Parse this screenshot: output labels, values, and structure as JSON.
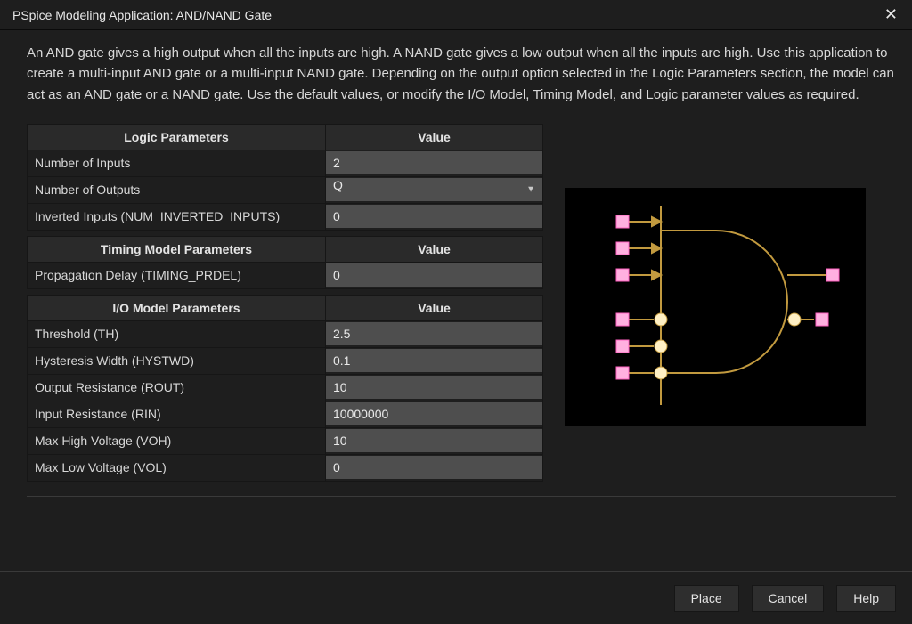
{
  "title": "PSpice Modeling Application: AND/NAND Gate",
  "description": "An AND gate gives a high output when all the inputs are high. A NAND gate gives a low output when all the inputs are high. Use this application to create a multi-input AND gate or a multi-input NAND gate. Depending on the output option selected in the Logic Parameters section, the model can act as an AND gate or a NAND gate. Use the default values, or modify the I/O Model, Timing Model, and Logic parameter values as required.",
  "sections": {
    "logic": {
      "header_label": "Logic Parameters",
      "header_value": "Value",
      "rows": {
        "num_inputs": {
          "label": "Number of Inputs",
          "value": "2"
        },
        "num_outputs": {
          "label": "Number of Outputs",
          "value": "Q"
        },
        "inverted_inputs": {
          "label": "Inverted Inputs (NUM_INVERTED_INPUTS)",
          "value": "0"
        }
      }
    },
    "timing": {
      "header_label": "Timing Model Parameters",
      "header_value": "Value",
      "rows": {
        "prop_delay": {
          "label": "Propagation Delay (TIMING_PRDEL)",
          "value": "0"
        }
      }
    },
    "io": {
      "header_label": "I/O Model Parameters",
      "header_value": "Value",
      "rows": {
        "threshold": {
          "label": "Threshold (TH)",
          "value": "2.5"
        },
        "hysteresis": {
          "label": "Hysteresis Width (HYSTWD)",
          "value": "0.1"
        },
        "rout": {
          "label": "Output Resistance (ROUT)",
          "value": "10"
        },
        "rin": {
          "label": "Input Resistance (RIN)",
          "value": "10000000"
        },
        "voh": {
          "label": "Max High Voltage (VOH)",
          "value": "10"
        },
        "vol": {
          "label": "Max Low Voltage (VOL)",
          "value": "0"
        }
      }
    }
  },
  "buttons": {
    "place": "Place",
    "cancel": "Cancel",
    "help": "Help"
  }
}
